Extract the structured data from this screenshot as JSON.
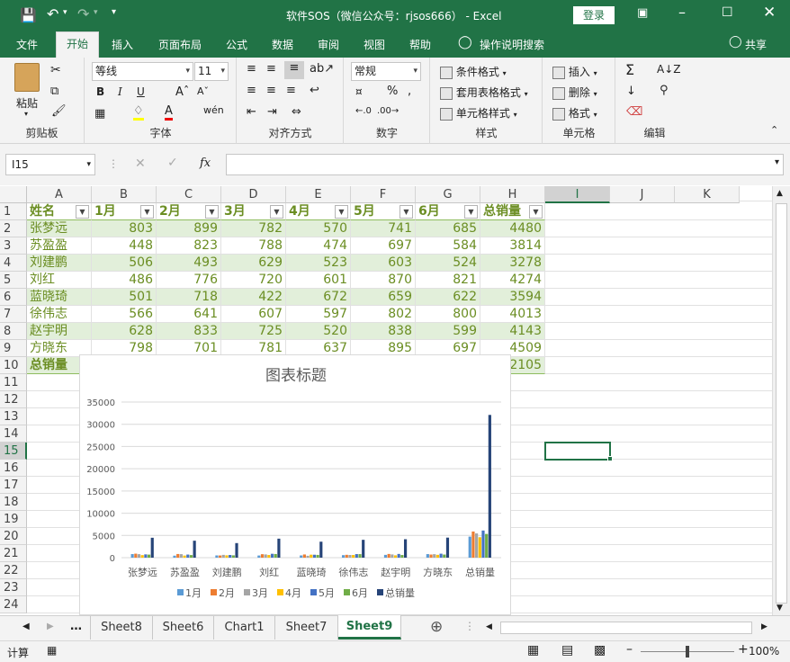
{
  "window": {
    "title": "软件SOS（微信公众号：rjsos666） - Excel",
    "login": "登录"
  },
  "ribbon_tabs": [
    "文件",
    "开始",
    "插入",
    "页面布局",
    "公式",
    "数据",
    "审阅",
    "视图",
    "帮助"
  ],
  "active_tab": "开始",
  "search_label": "操作说明搜索",
  "share_label": "共享",
  "ribbon": {
    "clipboard": {
      "paste": "粘贴",
      "label": "剪贴板"
    },
    "font": {
      "name": "等线",
      "size": "11",
      "label": "字体",
      "bold": "B",
      "italic": "I",
      "underline": "U"
    },
    "align": {
      "label": "对齐方式"
    },
    "number": {
      "format": "常规",
      "label": "数字"
    },
    "styles": {
      "cond": "条件格式",
      "table": "套用表格格式",
      "cell": "单元格样式",
      "label": "样式"
    },
    "cells": {
      "insert": "插入",
      "delete": "删除",
      "format": "格式",
      "label": "单元格"
    },
    "editing": {
      "label": "编辑"
    }
  },
  "formula_bar": {
    "name_box": "I15",
    "fx": "fx",
    "value": ""
  },
  "columns": [
    "A",
    "B",
    "C",
    "D",
    "E",
    "F",
    "G",
    "H",
    "I",
    "J",
    "K"
  ],
  "rows": [
    "1",
    "2",
    "3",
    "4",
    "5",
    "6",
    "7",
    "8",
    "9",
    "10",
    "11",
    "12",
    "13",
    "14",
    "15",
    "16",
    "17",
    "18",
    "19",
    "20",
    "21",
    "22",
    "23",
    "24"
  ],
  "table": {
    "headers": [
      "姓名",
      "1月",
      "2月",
      "3月",
      "4月",
      "5月",
      "6月",
      "总销量"
    ],
    "data": [
      [
        "张梦远",
        "803",
        "899",
        "782",
        "570",
        "741",
        "685",
        "4480"
      ],
      [
        "苏盈盈",
        "448",
        "823",
        "788",
        "474",
        "697",
        "584",
        "3814"
      ],
      [
        "刘建鹏",
        "506",
        "493",
        "629",
        "523",
        "603",
        "524",
        "3278"
      ],
      [
        "刘红",
        "486",
        "776",
        "720",
        "601",
        "870",
        "821",
        "4274"
      ],
      [
        "蓝晓琦",
        "501",
        "718",
        "422",
        "672",
        "659",
        "622",
        "3594"
      ],
      [
        "徐伟志",
        "566",
        "641",
        "607",
        "597",
        "802",
        "800",
        "4013"
      ],
      [
        "赵宇明",
        "628",
        "833",
        "725",
        "520",
        "838",
        "599",
        "4143"
      ],
      [
        "方晓东",
        "798",
        "701",
        "781",
        "637",
        "895",
        "697",
        "4509"
      ]
    ],
    "total_label": "总销量",
    "total_value": "32105"
  },
  "chart_data": {
    "type": "bar",
    "title": "图表标题",
    "categories": [
      "张梦远",
      "苏盈盈",
      "刘建鹏",
      "刘红",
      "蓝晓琦",
      "徐伟志",
      "赵宇明",
      "方晓东",
      "总销量"
    ],
    "ylim": [
      0,
      35000
    ],
    "yticks": [
      "35000",
      "30000",
      "25000",
      "20000",
      "15000",
      "10000",
      "5000",
      "0"
    ],
    "legend_position": "bottom",
    "colors": [
      "#5b9bd5",
      "#ed7d31",
      "#a5a5a5",
      "#ffc000",
      "#4472c4",
      "#70ad47",
      "#264478"
    ],
    "series": [
      {
        "name": "1月",
        "values": [
          803,
          448,
          506,
          486,
          501,
          566,
          628,
          798,
          4736
        ]
      },
      {
        "name": "2月",
        "values": [
          899,
          823,
          493,
          776,
          718,
          641,
          833,
          701,
          5884
        ]
      },
      {
        "name": "3月",
        "values": [
          782,
          788,
          629,
          720,
          422,
          607,
          725,
          781,
          5454
        ]
      },
      {
        "name": "4月",
        "values": [
          570,
          474,
          523,
          601,
          672,
          597,
          520,
          637,
          4594
        ]
      },
      {
        "name": "5月",
        "values": [
          741,
          697,
          603,
          870,
          659,
          802,
          838,
          895,
          6105
        ]
      },
      {
        "name": "6月",
        "values": [
          685,
          584,
          524,
          821,
          622,
          800,
          599,
          697,
          5332
        ]
      },
      {
        "name": "总销量",
        "values": [
          4480,
          3814,
          3278,
          4274,
          3594,
          4013,
          4143,
          4509,
          32105
        ]
      }
    ]
  },
  "sheets": [
    "Sheet8",
    "Sheet6",
    "Chart1",
    "Sheet7",
    "Sheet9"
  ],
  "active_sheet": "Sheet9",
  "status": {
    "mode": "计算",
    "zoom": "100%"
  }
}
